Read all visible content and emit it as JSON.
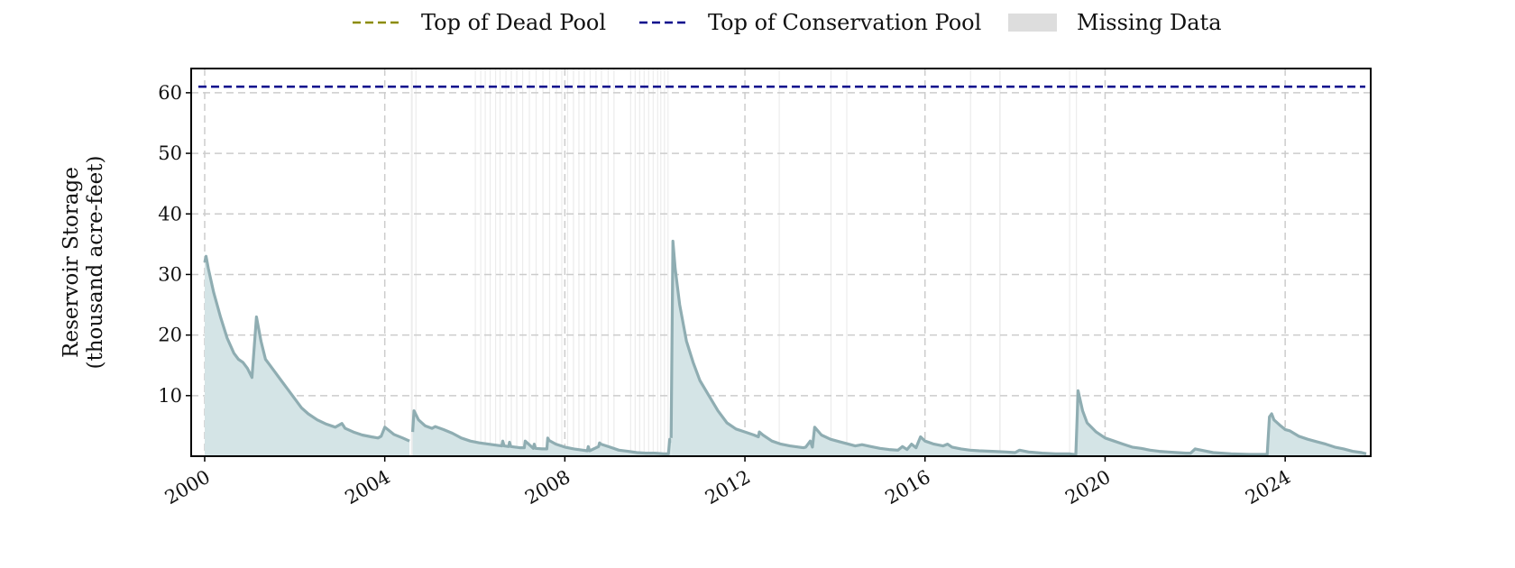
{
  "legend": [
    {
      "name": "dead-pool",
      "label": "Top of Dead Pool",
      "kind": "dashed",
      "color": "#8b8b00"
    },
    {
      "name": "conservation-pool",
      "label": "Top of Conservation Pool",
      "kind": "dashed",
      "color": "#00008b"
    },
    {
      "name": "missing-data",
      "label": "Missing Data",
      "kind": "patch",
      "color": "#dddddd"
    }
  ],
  "chart_data": {
    "type": "area",
    "title": "",
    "xlabel": "",
    "ylabel_lines": [
      "Reservoir Storage",
      "(thousand acre-feet)"
    ],
    "xlim": [
      1999.7,
      2025.9
    ],
    "ylim": [
      0,
      64
    ],
    "xticks": [
      2000,
      2004,
      2008,
      2012,
      2016,
      2020,
      2024
    ],
    "xtick_labels": [
      "2000",
      "2004",
      "2008",
      "2012",
      "2016",
      "2020",
      "2024"
    ],
    "yticks": [
      10,
      20,
      30,
      40,
      50,
      60
    ],
    "ytick_labels": [
      "10",
      "20",
      "30",
      "40",
      "50",
      "60"
    ],
    "grid": true,
    "legend_position": "top-center",
    "series_color": "#8fadb2",
    "fill_color": "#d4e4e6",
    "conservation_pool_level": 61,
    "missing_color": "#dddddd",
    "missing_data_periods": [
      [
        2004.58,
        2004.62
      ],
      [
        2004.68,
        2004.7
      ],
      [
        2006.0,
        2006.02
      ],
      [
        2006.12,
        2006.13
      ],
      [
        2006.22,
        2006.24
      ],
      [
        2006.33,
        2006.34
      ],
      [
        2006.45,
        2006.47
      ],
      [
        2006.55,
        2006.56
      ],
      [
        2006.68,
        2006.7
      ],
      [
        2006.8,
        2006.81
      ],
      [
        2006.92,
        2006.94
      ],
      [
        2007.05,
        2007.06
      ],
      [
        2007.2,
        2007.22
      ],
      [
        2007.35,
        2007.36
      ],
      [
        2007.5,
        2007.52
      ],
      [
        2007.65,
        2007.66
      ],
      [
        2007.8,
        2007.82
      ],
      [
        2007.92,
        2007.94
      ],
      [
        2008.05,
        2008.06
      ],
      [
        2008.18,
        2008.2
      ],
      [
        2008.3,
        2008.32
      ],
      [
        2008.42,
        2008.43
      ],
      [
        2008.55,
        2008.57
      ],
      [
        2008.68,
        2008.69
      ],
      [
        2008.8,
        2008.82
      ],
      [
        2008.95,
        2008.96
      ],
      [
        2009.08,
        2009.1
      ],
      [
        2009.45,
        2009.46
      ],
      [
        2009.55,
        2009.57
      ],
      [
        2009.65,
        2009.66
      ],
      [
        2009.75,
        2009.77
      ],
      [
        2009.85,
        2009.86
      ],
      [
        2009.95,
        2009.97
      ],
      [
        2010.05,
        2010.06
      ],
      [
        2010.12,
        2010.14
      ],
      [
        2010.2,
        2010.21
      ],
      [
        2010.28,
        2010.3
      ],
      [
        2012.75,
        2012.77
      ],
      [
        2013.9,
        2013.92
      ],
      [
        2014.25,
        2014.27
      ],
      [
        2017.0,
        2017.02
      ],
      [
        2017.65,
        2017.68
      ],
      [
        2019.2,
        2019.22
      ],
      [
        2019.35,
        2019.37
      ]
    ],
    "segments": [
      {
        "x": [
          2000.0,
          2000.03,
          2000.08,
          2000.2,
          2000.35,
          2000.5,
          2000.65,
          2000.75,
          2000.85,
          2000.95,
          2001.05,
          2001.15,
          2001.2,
          2001.25,
          2001.35,
          2001.45,
          2001.55,
          2001.7,
          2001.85,
          2002.0,
          2002.15,
          2002.3,
          2002.5,
          2002.7,
          2002.9,
          2003.05,
          2003.12,
          2003.3,
          2003.5,
          2003.7,
          2003.85,
          2003.92,
          2004.0,
          2004.2,
          2004.4,
          2004.55
        ],
        "y": [
          32,
          33,
          31,
          27,
          23,
          19.5,
          17,
          16,
          15.5,
          14.5,
          13,
          23,
          21,
          19,
          16,
          15,
          14,
          12.5,
          11,
          9.5,
          8,
          7,
          6,
          5.3,
          4.8,
          5.4,
          4.6,
          4.0,
          3.5,
          3.2,
          3.0,
          3.3,
          4.8,
          3.6,
          3.0,
          2.5
        ]
      },
      {
        "x": [
          2004.62,
          2004.65,
          2004.75,
          2004.9,
          2005.05,
          2005.12,
          2005.3,
          2005.5,
          2005.7,
          2005.9,
          2006.1,
          2006.3,
          2006.5,
          2006.6,
          2006.62,
          2006.65,
          2006.75,
          2006.77,
          2006.8,
          2007.0,
          2007.1,
          2007.12,
          2007.3,
          2007.32,
          2007.35,
          2007.5,
          2007.6,
          2007.62,
          2007.65,
          2007.8,
          2008.0,
          2008.2,
          2008.4,
          2008.5,
          2008.52,
          2008.55,
          2008.75,
          2008.77,
          2008.8,
          2009.0,
          2009.2,
          2009.4,
          2009.6,
          2009.8,
          2010.0,
          2010.2,
          2010.3,
          2010.33,
          2010.36
        ],
        "y": [
          4.0,
          7.5,
          6.0,
          5.0,
          4.6,
          4.9,
          4.4,
          3.8,
          3.0,
          2.5,
          2.2,
          2.0,
          1.8,
          1.7,
          2.5,
          1.7,
          1.6,
          2.3,
          1.6,
          1.4,
          1.4,
          2.5,
          1.3,
          2.0,
          1.3,
          1.2,
          1.2,
          3.0,
          2.6,
          2.0,
          1.5,
          1.2,
          1.0,
          0.9,
          1.6,
          0.9,
          1.6,
          2.2,
          2.0,
          1.5,
          1.0,
          0.8,
          0.6,
          0.5,
          0.5,
          0.4,
          0.4,
          2.8,
          2.2
        ]
      },
      {
        "x": [
          2010.36,
          2010.4,
          2010.45,
          2010.55,
          2010.7,
          2010.85,
          2011.0,
          2011.2,
          2011.4,
          2011.6,
          2011.8,
          2012.0,
          2012.2,
          2012.3,
          2012.32,
          2012.4,
          2012.6,
          2012.8,
          2013.0,
          2013.2,
          2013.3,
          2013.35,
          2013.45,
          2013.5,
          2013.55,
          2013.7,
          2013.9,
          2014.1,
          2014.3,
          2014.45,
          2014.6,
          2014.8,
          2015.0,
          2015.2,
          2015.4,
          2015.5,
          2015.6,
          2015.7,
          2015.8,
          2015.9,
          2016.0,
          2016.2,
          2016.4,
          2016.5,
          2016.6,
          2016.8,
          2017.0,
          2017.2,
          2017.5,
          2017.8,
          2018.0,
          2018.1,
          2018.3,
          2018.6,
          2018.9,
          2019.2,
          2019.3,
          2019.35,
          2019.4,
          2019.5,
          2019.6,
          2019.8,
          2020.0,
          2020.2,
          2020.4,
          2020.6,
          2020.8,
          2021.0,
          2021.2,
          2021.4,
          2021.6,
          2021.8,
          2021.9,
          2022.0,
          2022.4,
          2022.8,
          2023.2,
          2023.55,
          2023.6,
          2023.65,
          2023.7,
          2023.75,
          2023.9,
          2024.0,
          2024.1,
          2024.3,
          2024.5,
          2024.7,
          2024.9,
          2025.1,
          2025.3,
          2025.5,
          2025.7,
          2025.8
        ],
        "y": [
          3,
          35.5,
          31,
          25,
          19,
          15.5,
          12.5,
          10.0,
          7.5,
          5.5,
          4.5,
          4.0,
          3.5,
          3.2,
          4.0,
          3.5,
          2.5,
          2.0,
          1.7,
          1.5,
          1.4,
          1.5,
          2.5,
          1.5,
          4.8,
          3.5,
          2.8,
          2.4,
          2.0,
          1.7,
          1.9,
          1.6,
          1.3,
          1.1,
          1.0,
          1.6,
          1.1,
          2.0,
          1.4,
          3.2,
          2.5,
          2.0,
          1.7,
          2.0,
          1.5,
          1.2,
          1.0,
          0.9,
          0.8,
          0.7,
          0.6,
          1.0,
          0.7,
          0.5,
          0.4,
          0.4,
          0.3,
          0.3,
          10.8,
          7.5,
          5.5,
          4.0,
          3.0,
          2.5,
          2.0,
          1.5,
          1.3,
          1.0,
          0.8,
          0.7,
          0.6,
          0.5,
          0.5,
          1.2,
          0.6,
          0.4,
          0.3,
          0.3,
          0.3,
          6.5,
          7.0,
          6.0,
          5.0,
          4.4,
          4.2,
          3.3,
          2.8,
          2.4,
          2.0,
          1.5,
          1.2,
          0.8,
          0.6,
          0.4
        ]
      }
    ]
  }
}
